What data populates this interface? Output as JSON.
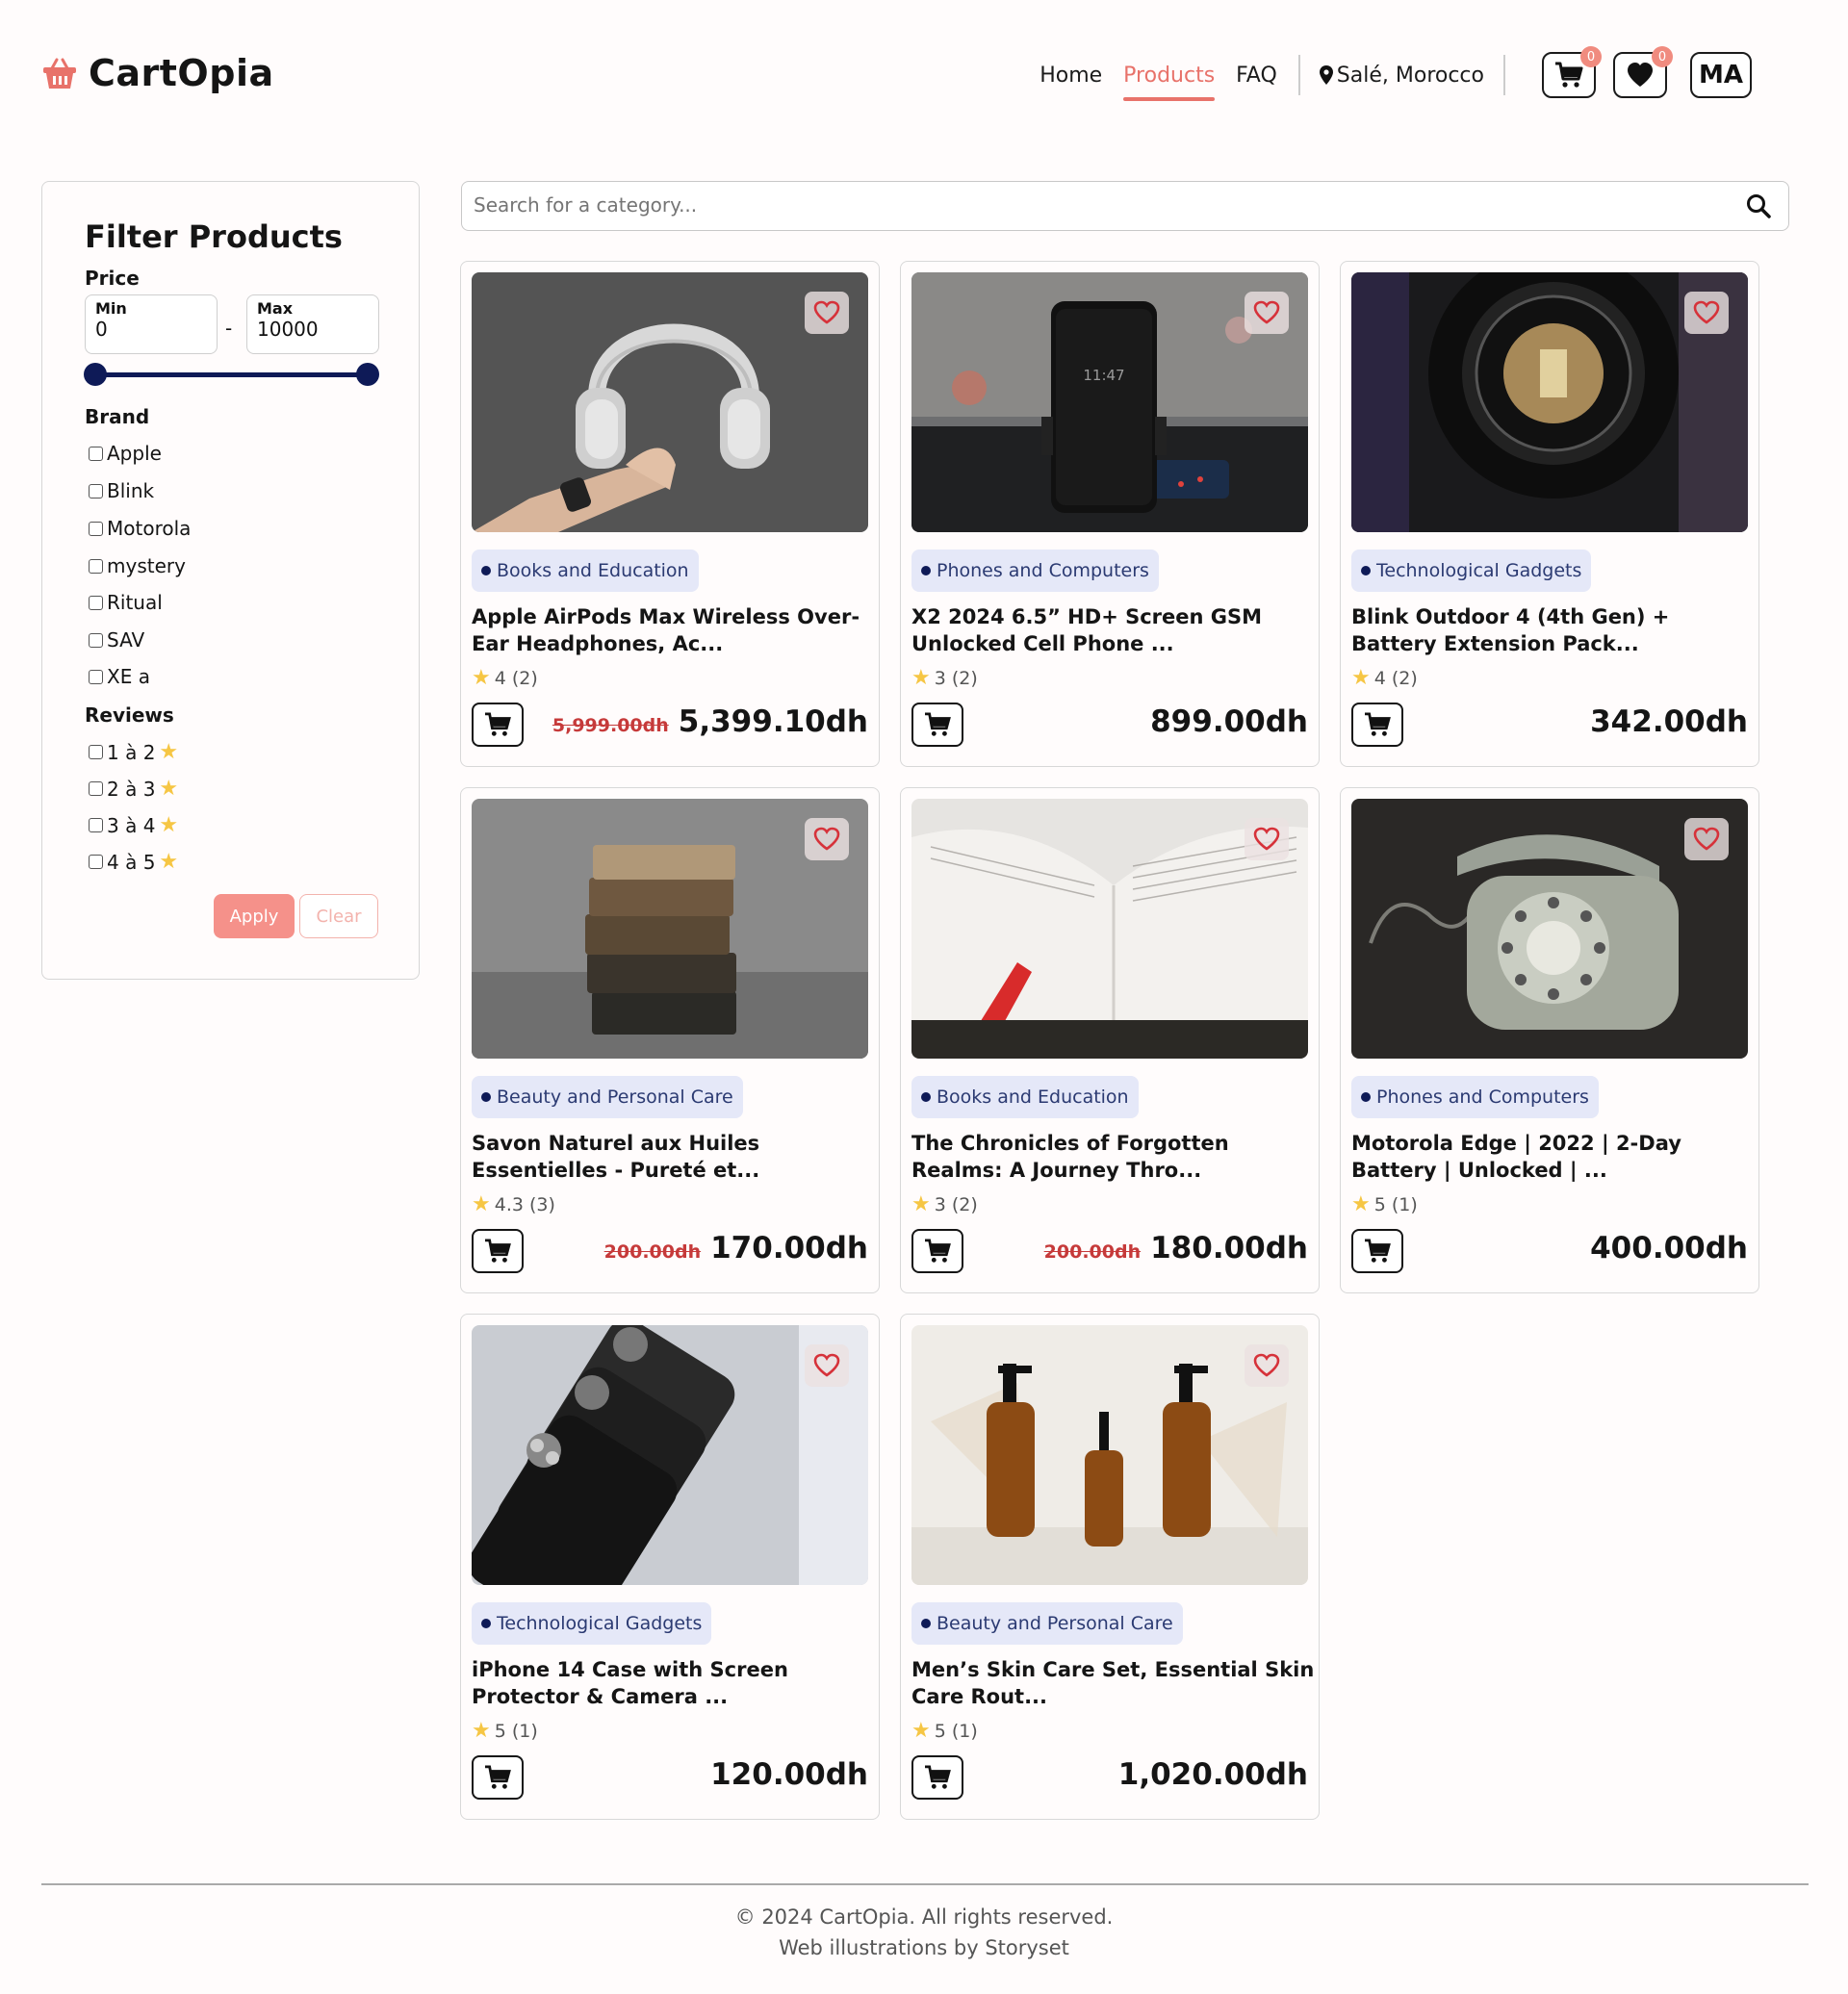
{
  "header": {
    "logo_text": "CartOpia",
    "nav": [
      "Home",
      "Products",
      "FAQ"
    ],
    "active_nav": "Products",
    "location": "Salé, Morocco",
    "cart_count": "0",
    "wishlist_count": "0",
    "avatar_initials": "MA"
  },
  "filter": {
    "title": "Filter Products",
    "price_label": "Price",
    "min_label": "Min",
    "min_value": "0",
    "max_label": "Max",
    "max_value": "10000",
    "dash": "-",
    "brand_label": "Brand",
    "brands": [
      "Apple",
      "Blink",
      "Motorola",
      "mystery",
      "Ritual",
      "SAV",
      "XE a"
    ],
    "reviews_label": "Reviews",
    "reviews": [
      "1 à 2",
      "2 à 3",
      "3 à 4",
      "4 à 5"
    ],
    "apply_label": "Apply",
    "clear_label": "Clear"
  },
  "search": {
    "placeholder": "Search for a category..."
  },
  "products": [
    {
      "category": "Books and Education",
      "title": "Apple AirPods Max Wireless Over-Ear Headphones, Ac...",
      "rating": "4 (2)",
      "old_price": "5,999.00dh",
      "price": "5,399.10dh"
    },
    {
      "category": "Phones and Computers",
      "title": "X2 2024 6.5” HD+ Screen GSM Unlocked Cell Phone ...",
      "rating": "3 (2)",
      "old_price": "",
      "price": "899.00dh",
      "screen_time": "11:47"
    },
    {
      "category": "Technological Gadgets",
      "title": "Blink Outdoor 4 (4th Gen) + Battery Extension Pack...",
      "rating": "4 (2)",
      "old_price": "",
      "price": "342.00dh"
    },
    {
      "category": "Beauty and Personal Care",
      "title": "Savon Naturel aux Huiles Essentielles - Pureté et...",
      "rating": "4.3 (3)",
      "old_price": "200.00dh",
      "price": "170.00dh"
    },
    {
      "category": "Books and Education",
      "title": "The Chronicles of Forgotten Realms: A Journey Thro...",
      "rating": "3 (2)",
      "old_price": "200.00dh",
      "price": "180.00dh"
    },
    {
      "category": "Phones and Computers",
      "title": "Motorola Edge | 2022 | 2-Day Battery | Unlocked | ...",
      "rating": "5 (1)",
      "old_price": "",
      "price": "400.00dh"
    },
    {
      "category": "Technological Gadgets",
      "title": "iPhone 14 Case with Screen Protector & Camera ...",
      "rating": "5 (1)",
      "old_price": "",
      "price": "120.00dh"
    },
    {
      "category": "Beauty and Personal Care",
      "title": "Men’s Skin Care Set, Essential Skin Care Rout...",
      "rating": "5 (1)",
      "old_price": "",
      "price": "1,020.00dh"
    }
  ],
  "footer": {
    "copyright": "© 2024 CartOpia. All rights reserved.",
    "credit": "Web illustrations by Storyset"
  },
  "colors": {
    "accent": "#e8726a",
    "navy": "#0e1a57",
    "star": "#f6c644"
  }
}
